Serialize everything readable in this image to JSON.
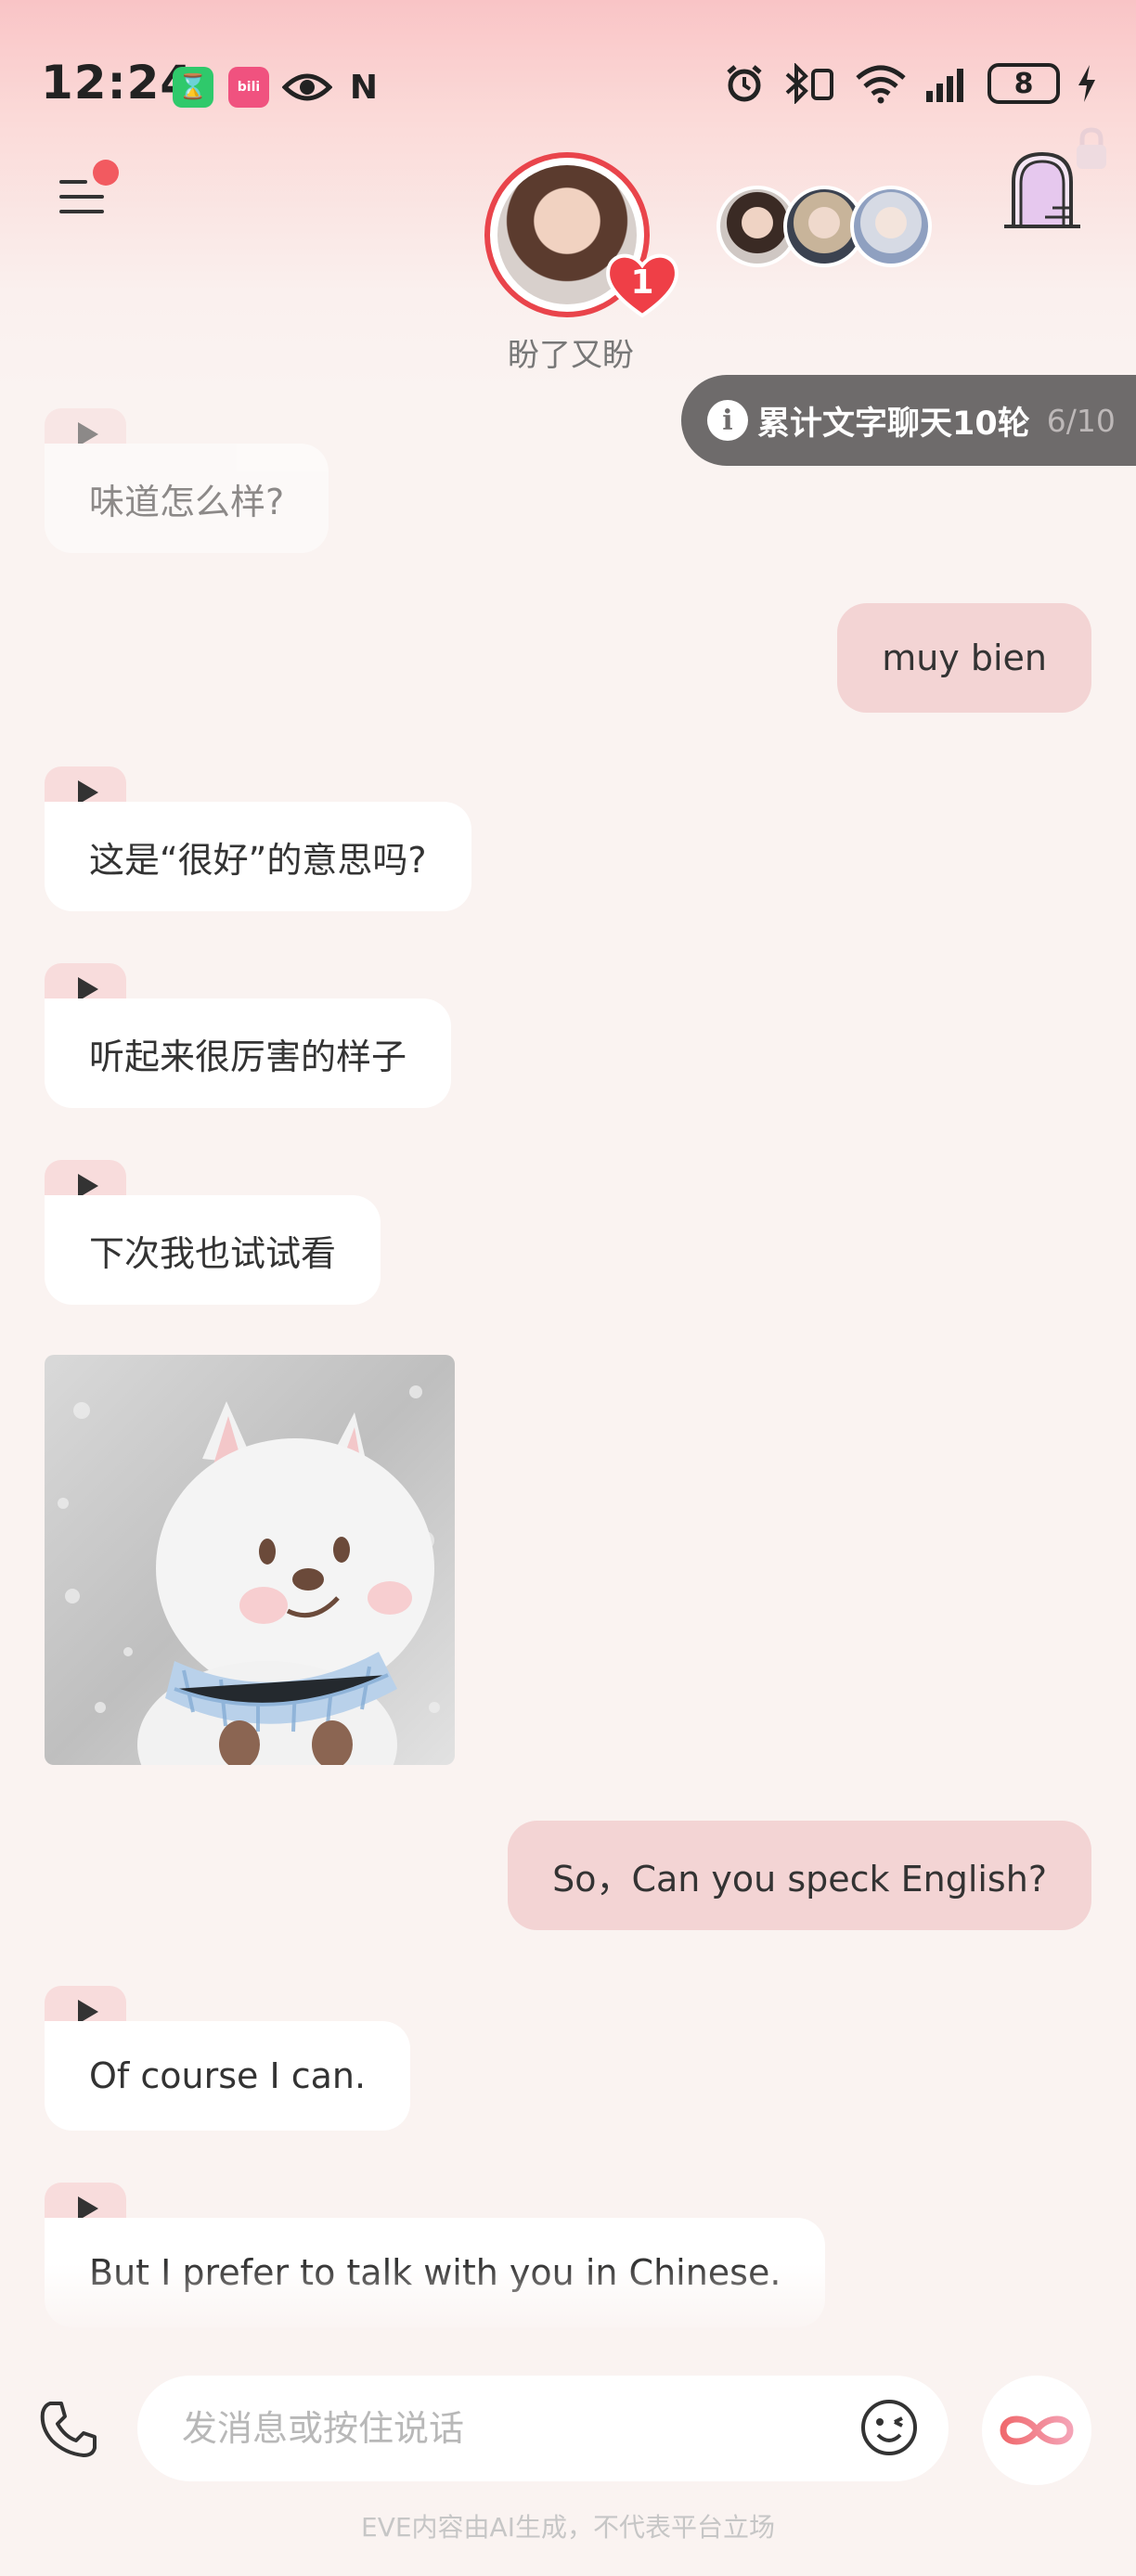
{
  "status_bar": {
    "time": "12:24",
    "battery": "8",
    "app2_label": "bili"
  },
  "header": {
    "character_name": "盼了又盼",
    "heart_count": "1"
  },
  "hint": {
    "text": "累计文字聊天10轮",
    "progress": "6/10"
  },
  "messages": {
    "m1": "味道怎么样?",
    "m2": "muy bien",
    "m3": "这是“很好”的意思吗?",
    "m4": "听起来很厉害的样子",
    "m5": "下次我也试试看",
    "m6": "So，Can you speck English?",
    "m7": "Of course I can.",
    "m8": "But I prefer to talk with you in Chinese."
  },
  "input": {
    "placeholder": "发消息或按住说话"
  },
  "footer": {
    "disclaimer": "EVE内容由AI生成，不代表平台立场"
  },
  "colors": {
    "accent": "#e9444b",
    "user_bubble": "#f3d4d4",
    "background": "#faf3f1"
  }
}
